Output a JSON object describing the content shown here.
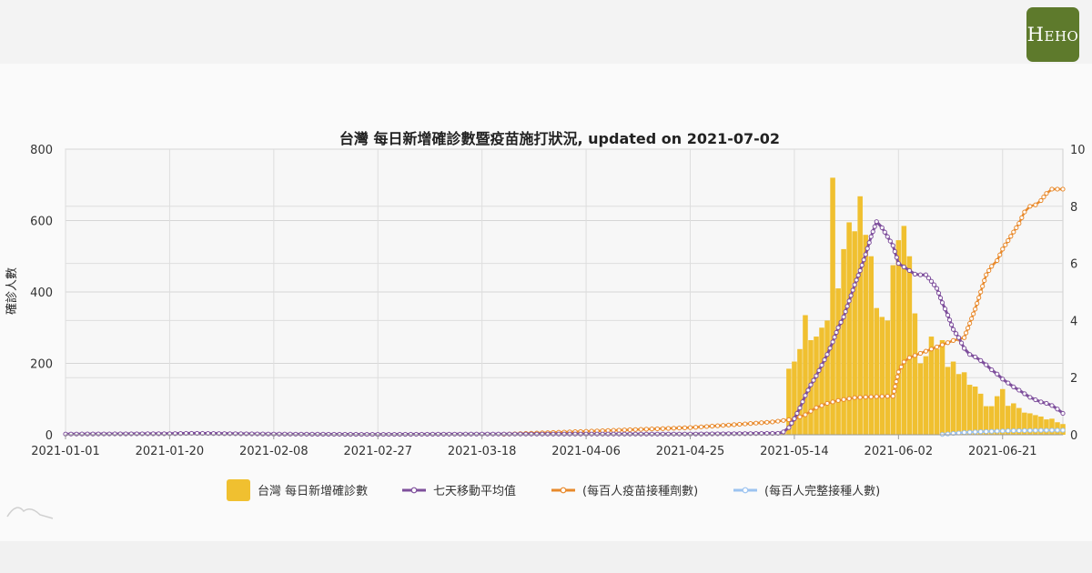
{
  "logo": {
    "brand": "HEHO",
    "first_letter": "H",
    "rest": "EHO"
  },
  "chart_data": {
    "type": "bar+line",
    "title": "台灣 每日新增確診數暨疫苗施打狀況, updated on 2021-07-02",
    "ylabel": "確診人數",
    "y2label": "",
    "ylim": [
      0,
      800
    ],
    "y2lim": [
      0,
      10
    ],
    "yticks": [
      "0",
      "200",
      "400",
      "600",
      "800"
    ],
    "y2ticks": [
      "0",
      "2",
      "4",
      "6",
      "8",
      "10"
    ],
    "xtick_labels": [
      "2021-01-01",
      "2021-01-20",
      "2021-02-08",
      "2021-02-27",
      "2021-03-18",
      "2021-04-06",
      "2021-04-25",
      "2021-05-14",
      "2021-06-02",
      "2021-06-21"
    ],
    "x_start": "2021-01-01",
    "x_end": "2021-07-02",
    "grid": true,
    "legend_position": "bottom",
    "colors": {
      "cases": "#f0c030",
      "avg": "#7e4f9c",
      "vacc": "#e8892b",
      "full": "#9cc3f0"
    },
    "series": [
      {
        "name": "台灣 每日新增確診數",
        "type": "bar",
        "start_date": "2021-05-12",
        "values": [
          8,
          185,
          205,
          240,
          335,
          265,
          275,
          300,
          320,
          720,
          410,
          520,
          595,
          570,
          668,
          560,
          500,
          355,
          330,
          320,
          475,
          545,
          585,
          500,
          340,
          200,
          220,
          275,
          240,
          265,
          190,
          205,
          170,
          175,
          140,
          135,
          115,
          80,
          80,
          108,
          128,
          81,
          88,
          75,
          62,
          60,
          55,
          51,
          43,
          45,
          35,
          30
        ]
      },
      {
        "name": "七天移動平均值",
        "type": "line",
        "axis": "left",
        "values": [
          [
            "2021-01-01",
            2
          ],
          [
            "2021-01-20",
            3
          ],
          [
            "2021-01-24",
            4
          ],
          [
            "2021-02-08",
            2
          ],
          [
            "2021-02-27",
            1
          ],
          [
            "2021-03-18",
            2
          ],
          [
            "2021-04-06",
            2
          ],
          [
            "2021-04-25",
            2
          ],
          [
            "2021-05-11",
            4
          ],
          [
            "2021-05-12",
            8
          ],
          [
            "2021-05-13",
            20
          ],
          [
            "2021-05-14",
            45
          ],
          [
            "2021-05-15",
            75
          ],
          [
            "2021-05-16",
            110
          ],
          [
            "2021-05-17",
            140
          ],
          [
            "2021-05-18",
            165
          ],
          [
            "2021-05-19",
            195
          ],
          [
            "2021-05-20",
            225
          ],
          [
            "2021-05-21",
            260
          ],
          [
            "2021-05-22",
            300
          ],
          [
            "2021-05-23",
            330
          ],
          [
            "2021-05-24",
            375
          ],
          [
            "2021-05-25",
            420
          ],
          [
            "2021-05-26",
            460
          ],
          [
            "2021-05-27",
            505
          ],
          [
            "2021-05-28",
            555
          ],
          [
            "2021-05-29",
            597
          ],
          [
            "2021-05-30",
            580
          ],
          [
            "2021-05-31",
            555
          ],
          [
            "2021-06-01",
            530
          ],
          [
            "2021-06-02",
            480
          ],
          [
            "2021-06-03",
            470
          ],
          [
            "2021-06-04",
            460
          ],
          [
            "2021-06-05",
            450
          ],
          [
            "2021-06-06",
            448
          ],
          [
            "2021-06-07",
            448
          ],
          [
            "2021-06-08",
            430
          ],
          [
            "2021-06-09",
            410
          ],
          [
            "2021-06-10",
            370
          ],
          [
            "2021-06-11",
            335
          ],
          [
            "2021-06-12",
            295
          ],
          [
            "2021-06-13",
            272
          ],
          [
            "2021-06-14",
            242
          ],
          [
            "2021-06-15",
            225
          ],
          [
            "2021-06-16",
            218
          ],
          [
            "2021-06-17",
            208
          ],
          [
            "2021-06-18",
            196
          ],
          [
            "2021-06-19",
            182
          ],
          [
            "2021-06-20",
            170
          ],
          [
            "2021-06-21",
            156
          ],
          [
            "2021-06-22",
            145
          ],
          [
            "2021-06-23",
            134
          ],
          [
            "2021-06-24",
            125
          ],
          [
            "2021-06-25",
            115
          ],
          [
            "2021-06-26",
            105
          ],
          [
            "2021-06-27",
            98
          ],
          [
            "2021-06-28",
            92
          ],
          [
            "2021-06-29",
            88
          ],
          [
            "2021-06-30",
            82
          ],
          [
            "2021-07-01",
            72
          ],
          [
            "2021-07-02",
            60
          ]
        ]
      },
      {
        "name": "(每百人疫苗接種劑數)",
        "type": "line",
        "axis": "right",
        "values": [
          [
            "2021-03-22",
            0.02
          ],
          [
            "2021-04-06",
            0.12
          ],
          [
            "2021-04-25",
            0.25
          ],
          [
            "2021-05-05",
            0.38
          ],
          [
            "2021-05-10",
            0.45
          ],
          [
            "2021-05-14",
            0.55
          ],
          [
            "2021-05-16",
            0.7
          ],
          [
            "2021-05-18",
            0.95
          ],
          [
            "2021-05-20",
            1.1
          ],
          [
            "2021-05-22",
            1.2
          ],
          [
            "2021-05-25",
            1.3
          ],
          [
            "2021-05-28",
            1.33
          ],
          [
            "2021-05-31",
            1.35
          ],
          [
            "2021-06-01",
            1.35
          ],
          [
            "2021-06-02",
            2.2
          ],
          [
            "2021-06-03",
            2.55
          ],
          [
            "2021-06-04",
            2.7
          ],
          [
            "2021-06-06",
            2.85
          ],
          [
            "2021-06-08",
            3.0
          ],
          [
            "2021-06-10",
            3.15
          ],
          [
            "2021-06-12",
            3.3
          ],
          [
            "2021-06-14",
            3.4
          ],
          [
            "2021-06-15",
            3.9
          ],
          [
            "2021-06-16",
            4.4
          ],
          [
            "2021-06-17",
            5.0
          ],
          [
            "2021-06-18",
            5.6
          ],
          [
            "2021-06-19",
            5.9
          ],
          [
            "2021-06-20",
            6.1
          ],
          [
            "2021-06-21",
            6.5
          ],
          [
            "2021-06-22",
            6.8
          ],
          [
            "2021-06-23",
            7.1
          ],
          [
            "2021-06-24",
            7.4
          ],
          [
            "2021-06-25",
            7.8
          ],
          [
            "2021-06-26",
            8.0
          ],
          [
            "2021-06-27",
            8.05
          ],
          [
            "2021-06-28",
            8.2
          ],
          [
            "2021-06-29",
            8.45
          ],
          [
            "2021-06-30",
            8.6
          ],
          [
            "2021-07-01",
            8.6
          ],
          [
            "2021-07-02",
            8.6
          ]
        ]
      },
      {
        "name": "(每百人完整接種人數)",
        "type": "line",
        "axis": "right",
        "values": [
          [
            "2021-06-10",
            0.01
          ],
          [
            "2021-06-14",
            0.08
          ],
          [
            "2021-06-16",
            0.1
          ],
          [
            "2021-06-19",
            0.12
          ],
          [
            "2021-06-22",
            0.14
          ],
          [
            "2021-06-26",
            0.15
          ],
          [
            "2021-06-30",
            0.16
          ],
          [
            "2021-07-02",
            0.16
          ]
        ]
      }
    ]
  }
}
